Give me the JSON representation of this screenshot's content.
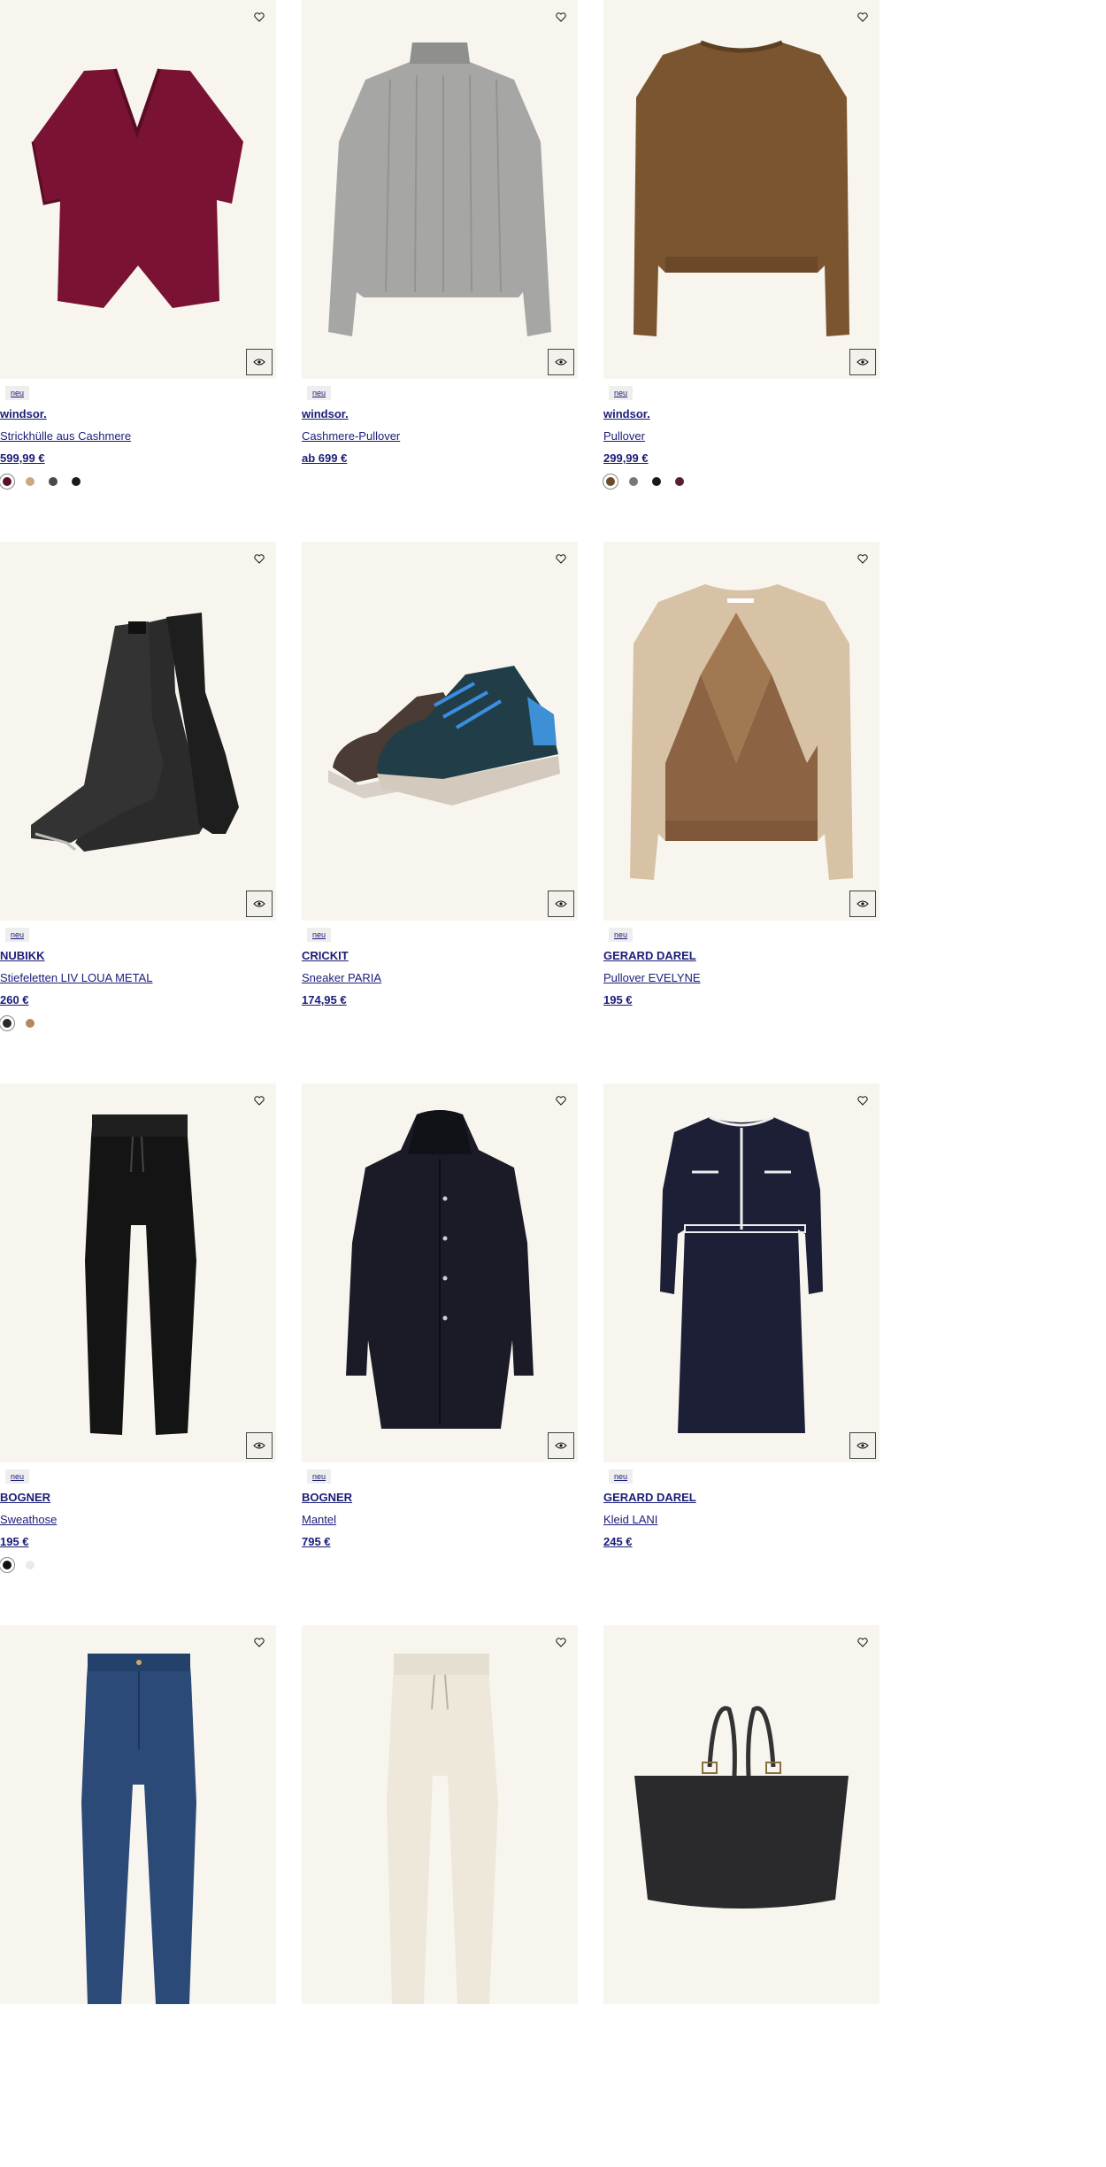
{
  "badge_label": "neu",
  "products": [
    {
      "brand": "windsor.",
      "name": "Strickhülle aus Cashmere",
      "price": "599,99 €",
      "art": "cardigan",
      "colors": [
        "#5a0f2a",
        "#c9a882",
        "#4a4a4a",
        "#1a1a1a"
      ]
    },
    {
      "brand": "windsor.",
      "name": "Cashmere-Pullover",
      "price": "ab 699 €",
      "art": "grey-sweater",
      "colors": []
    },
    {
      "brand": "windsor.",
      "name": "Pullover",
      "price": "299,99 €",
      "art": "brown-sweater",
      "colors": [
        "#6b4a2b",
        "#777777",
        "#1a1a1a",
        "#5a1f2e"
      ]
    },
    {
      "brand": "NUBIKK",
      "name": "Stiefeletten LIV LOUA METAL",
      "price": "260 €",
      "art": "boots",
      "colors": [
        "#2a2a2a",
        "#b38a5e"
      ]
    },
    {
      "brand": "CRICKIT",
      "name": "Sneaker PARIA",
      "price": "174,95 €",
      "art": "sneakers",
      "colors": []
    },
    {
      "brand": "GERARD DAREL",
      "name": "Pullover EVELYNE",
      "price": "195 €",
      "art": "argyle-sweater",
      "colors": []
    },
    {
      "brand": "BOGNER",
      "name": "Sweathose",
      "price": "195 €",
      "art": "black-pants",
      "colors": [
        "#111111",
        "#ecebe3"
      ]
    },
    {
      "brand": "BOGNER",
      "name": "Mantel",
      "price": "795 €",
      "art": "coat",
      "colors": []
    },
    {
      "brand": "GERARD DAREL",
      "name": "Kleid LANI",
      "price": "245 €",
      "art": "dress",
      "colors": []
    },
    {
      "brand": "",
      "name": "",
      "price": "",
      "art": "jeans",
      "colors": []
    },
    {
      "brand": "",
      "name": "",
      "price": "",
      "art": "cream-pants",
      "colors": []
    },
    {
      "brand": "",
      "name": "",
      "price": "",
      "art": "bag",
      "colors": []
    }
  ],
  "icons": {
    "wishlist": "heart-icon",
    "quick_view": "eye-icon"
  },
  "colors": {
    "link": "#1b1d78",
    "image_bg": "#f8f5ef"
  }
}
